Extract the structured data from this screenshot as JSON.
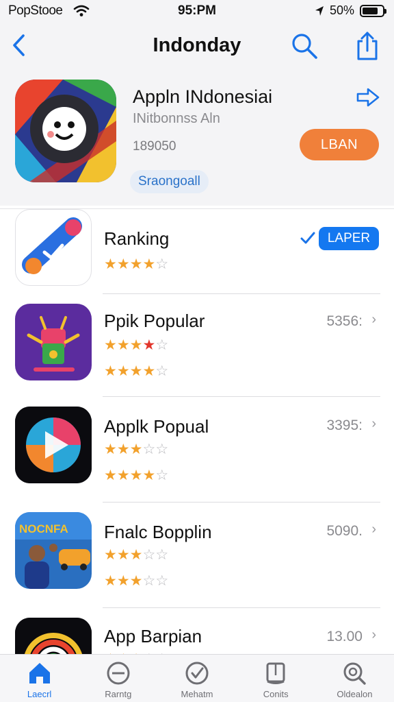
{
  "status_bar": {
    "carrier": "PopStooe",
    "time": "95:PM",
    "battery_text": "50%",
    "battery_level": 0.8
  },
  "nav": {
    "title": "Indonday",
    "icons": [
      "back-chevron-icon",
      "search-icon",
      "share-icon"
    ]
  },
  "featured": {
    "title": "Appln INdonesiai",
    "subtitle": "INitbonnss Aln",
    "count": "189050",
    "get_label": "LBAN",
    "chip_label": "Sraongoall"
  },
  "list": [
    {
      "title": "Ranking",
      "action_label": "LAPER",
      "stars": [
        4
      ],
      "value": ""
    },
    {
      "title": "Ppik Popular",
      "stars": [
        3,
        4
      ],
      "value": "5356:"
    },
    {
      "title": "Applk Popual",
      "stars": [
        3,
        4
      ],
      "value": "3395:"
    },
    {
      "title": "Fnalc Bopplin",
      "stars": [
        3,
        3
      ],
      "value": "5090."
    },
    {
      "title": "App Barpian",
      "stars": [
        3
      ],
      "value": "13.00"
    }
  ],
  "tabs": [
    {
      "label": "Laecrl",
      "icon": "home-icon",
      "active": true
    },
    {
      "label": "Rarntg",
      "icon": "ranking-icon",
      "active": false
    },
    {
      "label": "Mehatm",
      "icon": "check-circle-icon",
      "active": false
    },
    {
      "label": "Conits",
      "icon": "book-icon",
      "active": false
    },
    {
      "label": "Oldealon",
      "icon": "search-circle-icon",
      "active": false
    }
  ],
  "colors": {
    "accent": "#1a73e8",
    "get_button": "#f0803a",
    "star": "#f2a12c"
  }
}
